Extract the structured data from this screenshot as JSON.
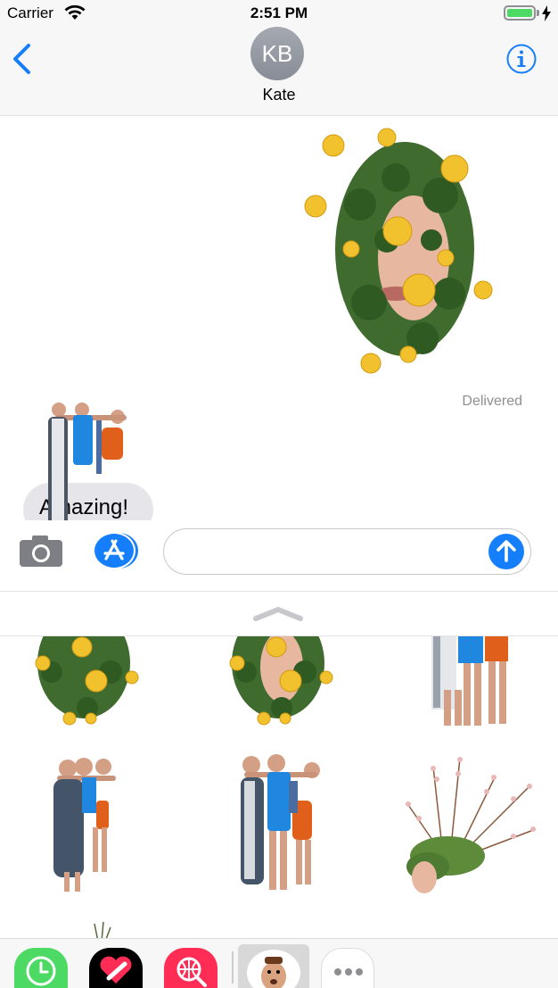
{
  "status_bar": {
    "carrier": "Carrier",
    "time": "2:51 PM",
    "battery_level": 1.0,
    "battery_color": "#4cd964",
    "wifi_icon": "wifi-icon",
    "charging_icon": "bolt-icon"
  },
  "header": {
    "back_icon": "chevron-left-icon",
    "avatar_initials": "KB",
    "contact_name": "Kate",
    "info_icon": "info-icon",
    "accent_color": "#147efb"
  },
  "conversation": {
    "sent_sticker": "flower-face-sticker",
    "delivered_label": "Delivered",
    "received_message": "Amazing!",
    "received_sticker": "three-figures-sticker"
  },
  "input_bar": {
    "camera_icon": "camera-icon",
    "appstore_icon": "app-store-icon",
    "message_placeholder": "",
    "send_icon": "send-arrow-icon"
  },
  "sticker_drawer": {
    "expand_icon": "chevron-up-icon",
    "stickers": [
      {
        "name": "flower-face-sticker"
      },
      {
        "name": "flower-face-sticker"
      },
      {
        "name": "three-figures-sticker"
      },
      {
        "name": "three-figures-sticker"
      },
      {
        "name": "three-figures-sticker"
      },
      {
        "name": "grass-head-sticker"
      },
      {
        "name": "grass-sprig-sticker"
      }
    ]
  },
  "app_strip": {
    "apps": [
      {
        "name": "recents-app",
        "color": "#4cd964"
      },
      {
        "name": "digital-touch-app",
        "color": "#000000"
      },
      {
        "name": "images-search-app",
        "color": "#ff2d55"
      },
      {
        "name": "sticker-pack-app",
        "color": "#d8d8d8"
      },
      {
        "name": "more-apps",
        "color": "#ffffff"
      }
    ]
  }
}
